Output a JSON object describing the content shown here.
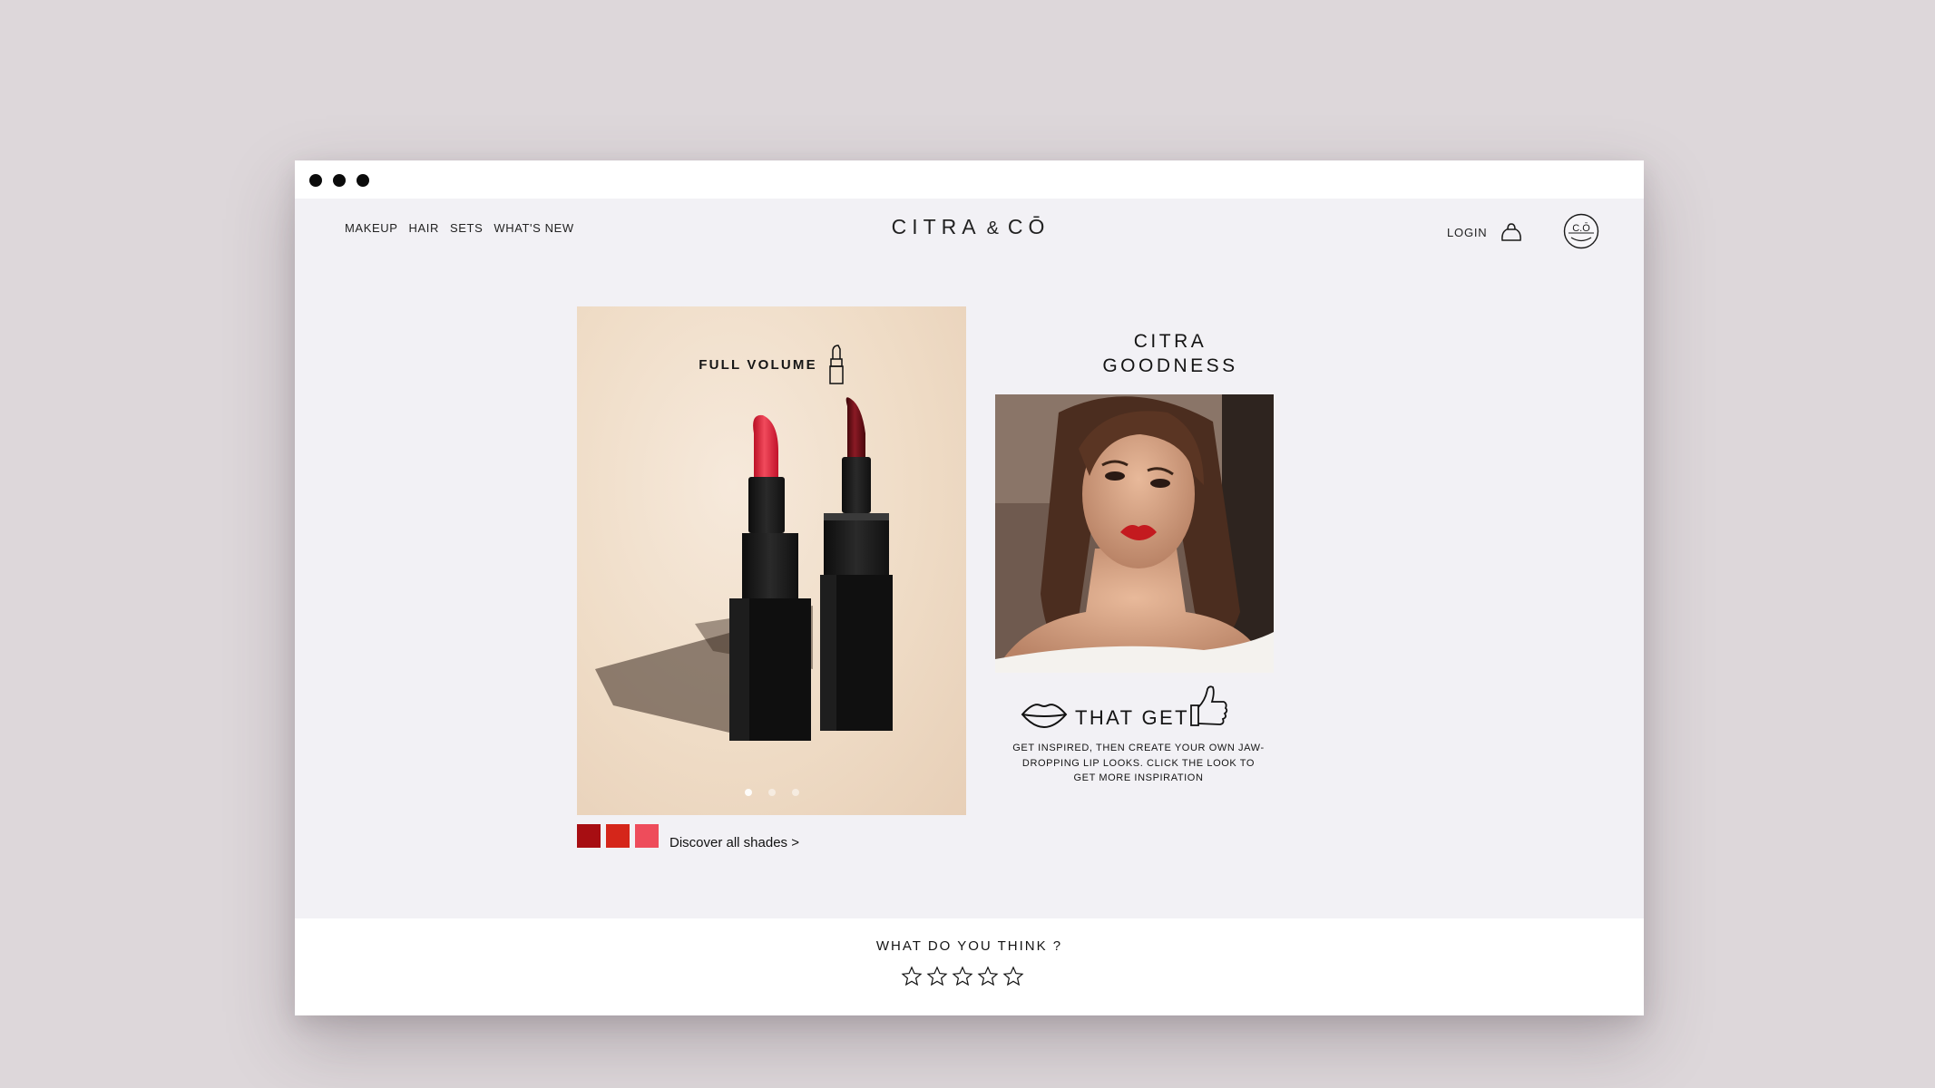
{
  "nav": {
    "items": [
      {
        "label": "MAKEUP"
      },
      {
        "label": "HAIR"
      },
      {
        "label": "SETS"
      },
      {
        "label": "WHAT'S NEW"
      }
    ]
  },
  "brand": {
    "name": "CITRA",
    "amp": "&",
    "suffix": "CŌ"
  },
  "header": {
    "login_label": "LOGIN",
    "cart_icon": "bag-icon",
    "account_icon": "avatar-icon"
  },
  "hero": {
    "title": "FULL VOLUME",
    "title_icon": "lipstick-icon",
    "slide_count": 3,
    "active_slide": 1
  },
  "shades": {
    "colors": [
      "#a70e12",
      "#d5261a",
      "#ee4c5b"
    ],
    "link_label": "Discover all shades >"
  },
  "feature": {
    "title_line1": "CITRA",
    "title_line2": "GOODNESS",
    "tagline_text": "THAT GET",
    "tagline_icons": [
      "lips-icon",
      "thumbs-up-icon"
    ],
    "description": "GET INSPIRED, THEN CREATE YOUR OWN JAW-DROPPING LIP LOOKS. CLICK THE LOOK TO GET MORE INSPIRATION"
  },
  "feedback": {
    "question": "WHAT DO YOU THINK ?",
    "star_count": 5,
    "rating": 0
  },
  "colors": {
    "page_background": "#ddd7da",
    "window_background": "#f2f1f5",
    "accent_red": "#d5261a"
  }
}
